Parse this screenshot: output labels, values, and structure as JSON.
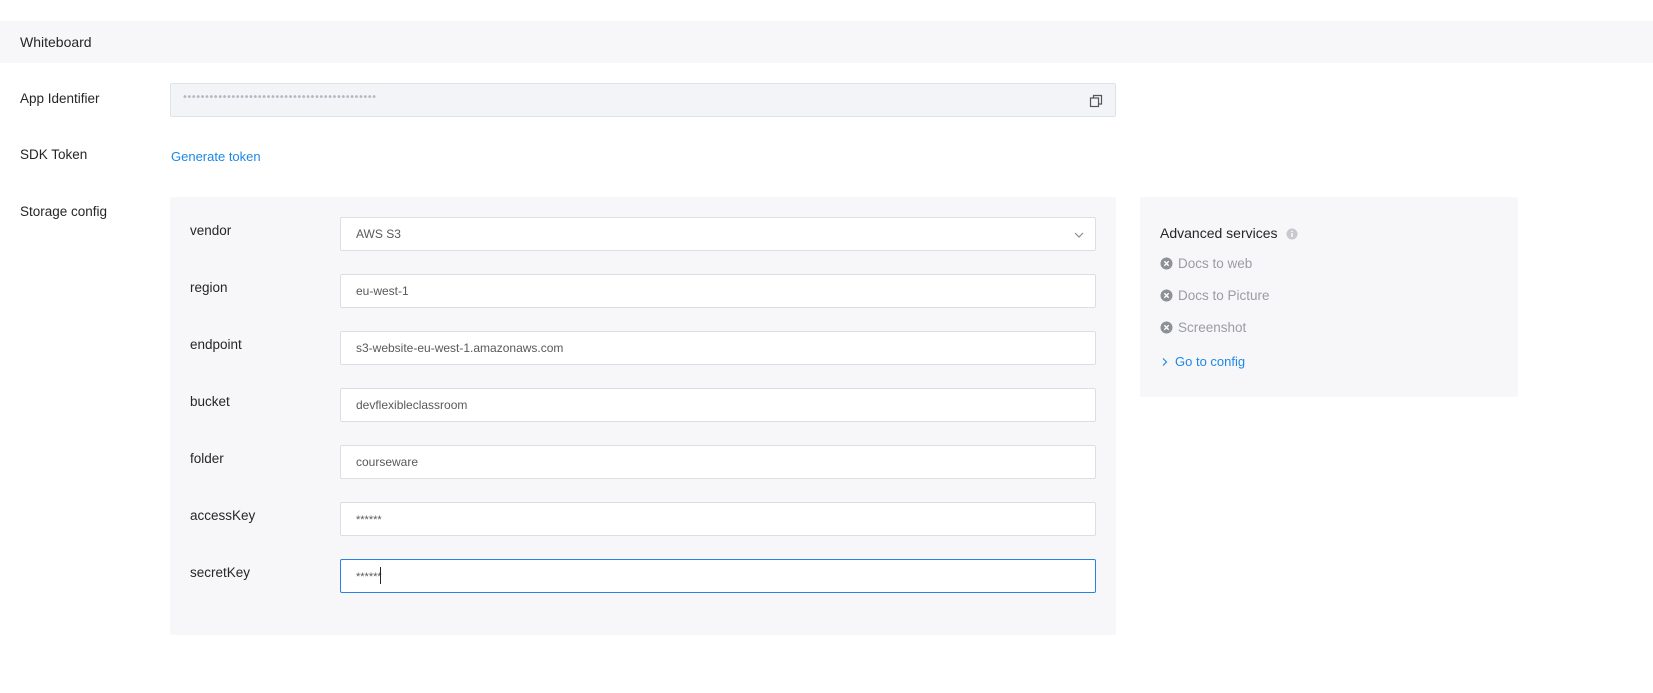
{
  "section": {
    "title": "Whiteboard"
  },
  "app_identifier": {
    "label": "App Identifier",
    "value_masked": "••••••••••••••••••••••••••••••••••••••••••••"
  },
  "sdk_token": {
    "label": "SDK Token",
    "action_label": "Generate token"
  },
  "storage_config": {
    "label": "Storage config",
    "vendor": {
      "label": "vendor",
      "value": "AWS S3"
    },
    "region": {
      "label": "region",
      "value": "eu-west-1"
    },
    "endpoint": {
      "label": "endpoint",
      "value": "s3-website-eu-west-1.amazonaws.com"
    },
    "bucket": {
      "label": "bucket",
      "value": "devflexibleclassroom"
    },
    "folder": {
      "label": "folder",
      "value": "courseware"
    },
    "accessKey": {
      "label": "accessKey",
      "value": "******"
    },
    "secretKey": {
      "label": "secretKey",
      "value": "******"
    }
  },
  "advanced_services": {
    "title": "Advanced services",
    "items": [
      {
        "label": "Docs to web",
        "icon": "close-circle-icon"
      },
      {
        "label": "Docs to Picture",
        "icon": "close-circle-icon"
      },
      {
        "label": "Screenshot",
        "icon": "close-circle-icon"
      }
    ],
    "config_link": "Go to config"
  },
  "colors": {
    "accent": "#1e88e5",
    "panel_bg": "#f7f7fa",
    "focus_border": "#2b7fe5",
    "disabled_text": "#9a9ca3"
  }
}
